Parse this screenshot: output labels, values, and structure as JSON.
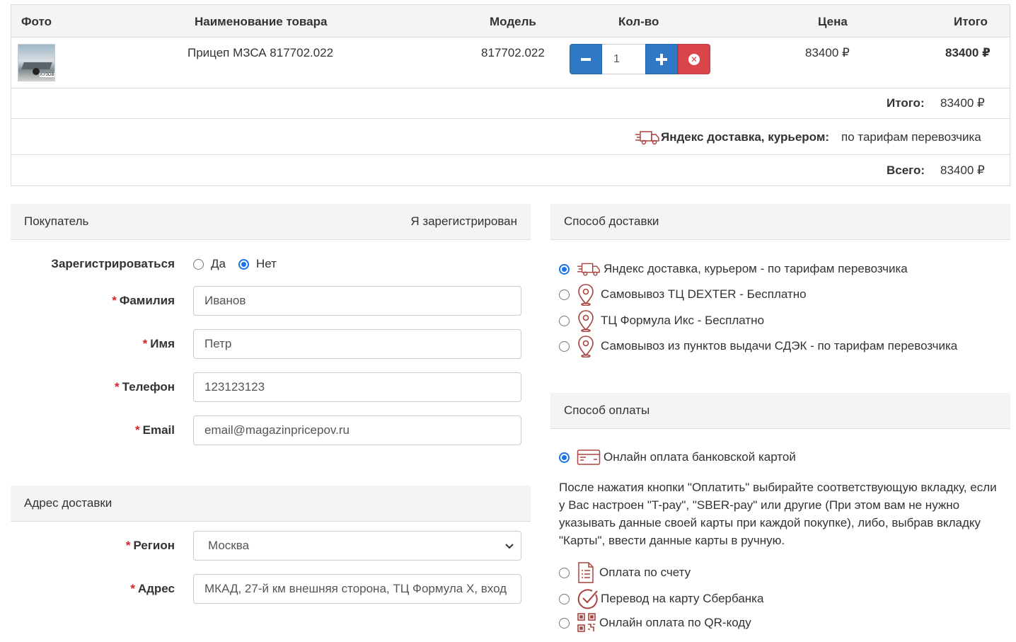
{
  "cart": {
    "columns": [
      "Фото",
      "Наименование товара",
      "Модель",
      "Кол-во",
      "Цена",
      "Итого"
    ],
    "item": {
      "thumb_text": "КУЗОВ",
      "name": "Прицеп МЗСА 817702.022",
      "model": "817702.022",
      "qty": "1",
      "price": "83400 ₽",
      "total": "83400 ₽"
    },
    "subtotal_label": "Итого:",
    "subtotal_value": "83400 ₽",
    "shipping_label": "Яндекс доставка, курьером:",
    "shipping_value": "по тарифам перевозчика",
    "grand_label": "Всего:",
    "grand_value": "83400 ₽"
  },
  "buyer": {
    "title": "Покупатель",
    "registered_link": "Я зарегистрирован",
    "register_label": "Зарегистрироваться",
    "yes": "Да",
    "no": "Нет",
    "register_selected": "no",
    "fields": {
      "lastname": {
        "label": "Фамилия",
        "value": "Иванов"
      },
      "firstname": {
        "label": "Имя",
        "value": "Петр"
      },
      "phone": {
        "label": "Телефон",
        "value": "123123123"
      },
      "email": {
        "label": "Email",
        "value": "email@magazinpricepov.ru"
      }
    }
  },
  "address": {
    "title": "Адрес доставки",
    "region": {
      "label": "Регион",
      "value": "Москва"
    },
    "addr": {
      "label": "Адрес",
      "value": "МКАД, 27-й км внешняя сторона, ТЦ Формула Х, вход"
    }
  },
  "delivery": {
    "title": "Способ доставки",
    "options": [
      {
        "label": "Яндекс доставка, курьером - по тарифам перевозчика",
        "icon": "truck-icon",
        "selected": true
      },
      {
        "label": "Самовывоз ТЦ DEXTER - Бесплатно",
        "icon": "map-pin-icon",
        "selected": false
      },
      {
        "label": "ТЦ Формула Икс - Бесплатно",
        "icon": "map-pin-icon",
        "selected": false
      },
      {
        "label": "Самовывоз из пунктов выдачи СДЭК - по тарифам перевозчика",
        "icon": "map-pin-icon",
        "selected": false
      }
    ]
  },
  "payment": {
    "title": "Способ оплаты",
    "options": [
      {
        "label": "Онлайн оплата банковской картой",
        "icon": "credit-card-icon",
        "selected": true
      },
      {
        "label": "Оплата по счету",
        "icon": "invoice-icon",
        "selected": false
      },
      {
        "label": "Перевод на карту Сбербанка",
        "icon": "check-circle-icon",
        "selected": false
      },
      {
        "label": "Онлайн оплата по QR-коду",
        "icon": "qr-code-icon",
        "selected": false
      }
    ],
    "description": "После нажатия кнопки \"Оплатить\" выбирайте соответствующую вкладку, если у Вас настроен \"T-pay\", \"SBER-pay\" или другие (При этом вам не нужно указывать данные своей карты при каждой покупке), либо, выбрав вкладку \"Карты\", ввести данные карты в ручную."
  },
  "colors": {
    "accent_blue": "#2f79c4",
    "danger_red": "#d9454a",
    "icon_red": "#a8433f",
    "radio_blue": "#1a73e8"
  }
}
